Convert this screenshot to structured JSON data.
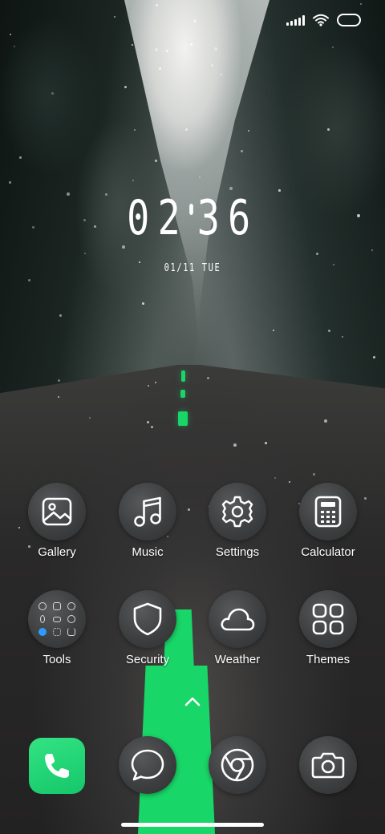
{
  "clock": {
    "hh": "02",
    "mm": "36"
  },
  "date": "01/11 TUE",
  "apps": [
    {
      "label": "Gallery",
      "icon": "gallery-icon"
    },
    {
      "label": "Music",
      "icon": "music-icon"
    },
    {
      "label": "Settings",
      "icon": "gear-icon"
    },
    {
      "label": "Calculator",
      "icon": "calculator-icon"
    },
    {
      "label": "Tools",
      "icon": "tools-folder-icon"
    },
    {
      "label": "Security",
      "icon": "shield-icon"
    },
    {
      "label": "Weather",
      "icon": "cloud-icon"
    },
    {
      "label": "Themes",
      "icon": "themes-icon"
    }
  ],
  "dock": [
    {
      "name": "Phone",
      "icon": "phone-icon"
    },
    {
      "name": "Messages",
      "icon": "chat-bubble-icon"
    },
    {
      "name": "Chrome",
      "icon": "chrome-icon"
    },
    {
      "name": "Camera",
      "icon": "camera-icon"
    }
  ],
  "colors": {
    "phone_green": "#1fd272",
    "road_stripe": "#18d667",
    "icon_bg": "#3d3f40"
  }
}
